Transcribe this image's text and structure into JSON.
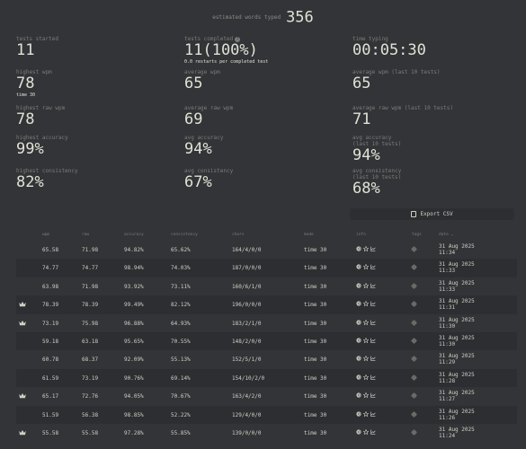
{
  "words": {
    "label": "estimated words typed",
    "value": "356"
  },
  "stats": {
    "tests_started": {
      "label": "tests started",
      "value": "11"
    },
    "tests_completed": {
      "label": "tests completed",
      "value": "11(100%)",
      "sub": "0.0 restarts per completed test"
    },
    "time_typing": {
      "label": "time typing",
      "value": "00:05:30"
    },
    "highest_wpm": {
      "label": "highest wpm",
      "value": "78",
      "sub": "time 30"
    },
    "average_wpm": {
      "label": "average wpm",
      "value": "65"
    },
    "average_wpm_last10": {
      "label": "average wpm (last 10 tests)",
      "value": "65"
    },
    "highest_raw": {
      "label": "highest raw wpm",
      "value": "78"
    },
    "average_raw": {
      "label": "average raw wpm",
      "value": "69"
    },
    "average_raw_last10": {
      "label": "average raw wpm (last 10 tests)",
      "value": "71"
    },
    "highest_accuracy": {
      "label": "highest accuracy",
      "value": "99%"
    },
    "avg_accuracy": {
      "label": "avg accuracy",
      "value": "94%"
    },
    "avg_accuracy_last10": {
      "label": "avg accuracy",
      "label2": "(last 10 tests)",
      "value": "94%"
    },
    "highest_consistency": {
      "label": "highest consistency",
      "value": "82%"
    },
    "avg_consistency": {
      "label": "avg consistency",
      "value": "67%"
    },
    "avg_consistency_last10": {
      "label": "avg consistency",
      "label2": "(last 10 tests)",
      "value": "68%"
    }
  },
  "export_label": "Export CSV",
  "table": {
    "headers": {
      "wpm": "wpm",
      "raw": "raw",
      "accuracy": "accuracy",
      "consistency": "consistency",
      "chars": "chars",
      "mode": "mode",
      "info": "info",
      "tags": "tags",
      "date": "date ⌄"
    },
    "rows": [
      {
        "pb": false,
        "wpm": "65.58",
        "raw": "71.98",
        "acc": "94.82%",
        "cons": "65.62%",
        "chars": "164/4/0/0",
        "mode": "time 30",
        "date1": "31 Aug 2025",
        "date2": "11:34"
      },
      {
        "pb": false,
        "wpm": "74.77",
        "raw": "74.77",
        "acc": "98.94%",
        "cons": "74.03%",
        "chars": "187/0/0/0",
        "mode": "time 30",
        "date1": "31 Aug 2025",
        "date2": "11:33"
      },
      {
        "pb": false,
        "wpm": "63.98",
        "raw": "71.98",
        "acc": "93.92%",
        "cons": "73.11%",
        "chars": "160/6/1/0",
        "mode": "time 30",
        "date1": "31 Aug 2025",
        "date2": "11:33"
      },
      {
        "pb": true,
        "wpm": "78.39",
        "raw": "78.39",
        "acc": "99.49%",
        "cons": "82.12%",
        "chars": "196/0/0/0",
        "mode": "time 30",
        "date1": "31 Aug 2025",
        "date2": "11:31"
      },
      {
        "pb": true,
        "wpm": "73.19",
        "raw": "75.98",
        "acc": "96.88%",
        "cons": "64.93%",
        "chars": "183/2/1/0",
        "mode": "time 30",
        "date1": "31 Aug 2025",
        "date2": "11:30"
      },
      {
        "pb": false,
        "wpm": "59.18",
        "raw": "63.18",
        "acc": "95.65%",
        "cons": "70.55%",
        "chars": "148/2/0/0",
        "mode": "time 30",
        "date1": "31 Aug 2025",
        "date2": "11:30"
      },
      {
        "pb": false,
        "wpm": "60.78",
        "raw": "68.37",
        "acc": "92.09%",
        "cons": "55.13%",
        "chars": "152/5/1/0",
        "mode": "time 30",
        "date1": "31 Aug 2025",
        "date2": "11:29"
      },
      {
        "pb": false,
        "wpm": "61.59",
        "raw": "73.19",
        "acc": "90.76%",
        "cons": "69.14%",
        "chars": "154/10/2/0",
        "mode": "time 30",
        "date1": "31 Aug 2025",
        "date2": "11:28"
      },
      {
        "pb": true,
        "wpm": "65.17",
        "raw": "72.76",
        "acc": "94.05%",
        "cons": "70.67%",
        "chars": "163/4/2/0",
        "mode": "time 30",
        "date1": "31 Aug 2025",
        "date2": "11:27"
      },
      {
        "pb": false,
        "wpm": "51.59",
        "raw": "56.38",
        "acc": "98.85%",
        "cons": "52.22%",
        "chars": "129/4/0/0",
        "mode": "time 30",
        "date1": "31 Aug 2025",
        "date2": "11:26"
      },
      {
        "pb": true,
        "wpm": "55.58",
        "raw": "55.58",
        "acc": "97.28%",
        "cons": "55.85%",
        "chars": "139/0/0/0",
        "mode": "time 30",
        "date1": "31 Aug 2025",
        "date2": "11:24"
      }
    ]
  }
}
